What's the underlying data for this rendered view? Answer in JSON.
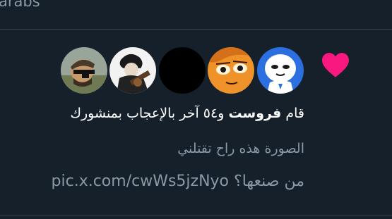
{
  "previous_tweet": {
    "partial_text": "arabs"
  },
  "notification": {
    "type_icon": "heart-icon",
    "accent_color": "#f91880",
    "avatars": [
      {
        "name": "avatar-1",
        "description": "illustrated user with sunglasses"
      },
      {
        "name": "avatar-2",
        "description": "anime character with guitar"
      },
      {
        "name": "avatar-3",
        "description": "black avatar"
      },
      {
        "name": "avatar-4",
        "description": "orange manga face"
      },
      {
        "name": "avatar-5",
        "description": "white cartoon face on blue"
      }
    ],
    "liked_prefix": "قام",
    "liked_user": "فروست",
    "liked_suffix": "و٥٤ آخر بالإعجاب بمنشورك",
    "tweet_line_1": "الصورة هذه راح تقتلني",
    "tweet_line_2_text": "من صنعها؟",
    "tweet_line_2_link": "pic.x.com/cwWs5jzNyo"
  },
  "colors": {
    "background": "#15202b",
    "divider": "#38444d",
    "secondary_text": "#8b98a5",
    "primary_text": "#ffffff"
  }
}
